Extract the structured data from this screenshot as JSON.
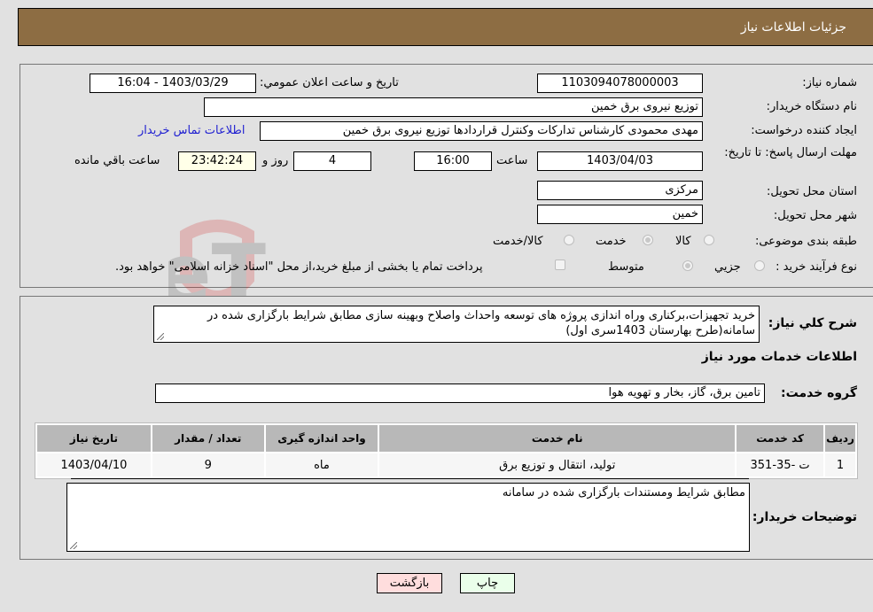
{
  "header": {
    "title": "جزئیات اطلاعات نیاز"
  },
  "form": {
    "need_number": {
      "label": "شماره نیاز:",
      "value": "1103094078000003"
    },
    "announce_datetime": {
      "label": "تاریخ و ساعت اعلان عمومي:",
      "value": "1403/03/29 - 16:04"
    },
    "buyer_org": {
      "label": "نام دستگاه خريدار:",
      "value": "توزیع نیروی برق خمین"
    },
    "creator": {
      "label": "ایجاد کننده درخواست:",
      "value": "مهدی محمودی کارشناس تدارکات وکنترل قراردادها توزیع نیروی برق خمین"
    },
    "buyer_contact_link": "اطلاعات تماس خريدار",
    "deadline": {
      "label": "مهلت ارسال پاسخ: تا تاریخ:",
      "date": "1403/04/03",
      "time_label": "ساعت",
      "time": "16:00",
      "days": "4",
      "days_label": "روز و",
      "remaining": "23:42:24",
      "remaining_label": "ساعت باقي مانده"
    },
    "delivery_province": {
      "label": "استان محل تحویل:",
      "value": "مرکزی"
    },
    "delivery_city": {
      "label": "شهر محل تحویل:",
      "value": "خمین"
    },
    "category": {
      "label": "طبقه بندی موضوعی:",
      "options": [
        "کالا",
        "خدمت",
        "کالا/خدمت"
      ],
      "selected": "خدمت"
    },
    "purchase_process": {
      "label": "نوع فرآیند خرید :",
      "options": [
        "جزيي",
        "متوسط"
      ],
      "selected": "متوسط",
      "treasury_checkbox_label": "پرداخت تمام یا بخشی از مبلغ خرید،از محل \"اسناد خزانه اسلامی\" خواهد بود.",
      "treasury_checked": false
    }
  },
  "details": {
    "description_label": "شرح كلي نياز:",
    "description": "خرید تجهیزات،برکناری وراه اندازی پروژه های توسعه واحداث واصلاح وبهینه سازی مطابق شرایط بارگزاری شده در سامانه(طرح بهارستان 1403سری اول)",
    "services_heading": "اطلاعات خدمات مورد نياز",
    "service_group_label": "گروه خدمت:",
    "service_group": "تامین برق، گاز، بخار و تهویه هوا",
    "table": {
      "headers": [
        "رديف",
        "کد خدمت",
        "نام خدمت",
        "واحد اندازه گیری",
        "تعداد / مقدار",
        "تاریخ نیاز"
      ],
      "rows": [
        [
          "1",
          "ت -35-351",
          "تولید، انتقال و توزیع برق",
          "ماه",
          "9",
          "1403/04/10"
        ]
      ]
    },
    "buyer_notes_label": "توضيحات خريدار:",
    "buyer_notes": "مطابق شرایط ومستندات بارگزاری شده در سامانه"
  },
  "buttons": {
    "print": "چاپ",
    "back": "بازگشت"
  },
  "colors": {
    "header_bg": "#8d6d43",
    "print_bg": "#eaffea",
    "back_bg": "#ffdddd",
    "link": "#1f1fd1"
  },
  "watermark": "AriaTender.neT"
}
